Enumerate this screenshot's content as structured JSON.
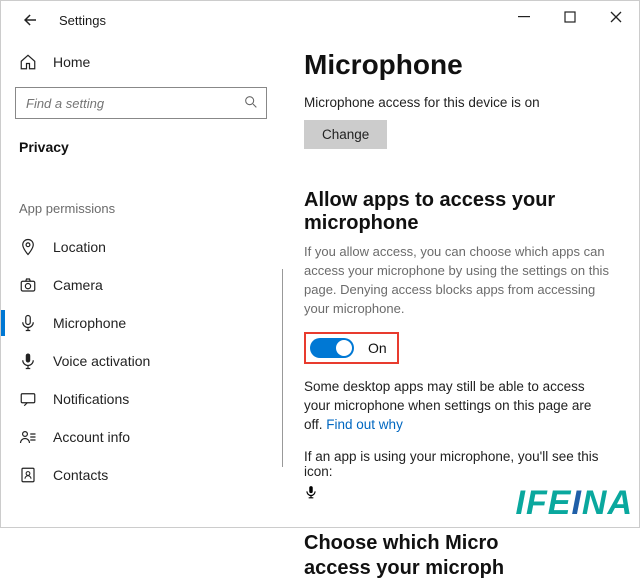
{
  "window": {
    "title": "Settings"
  },
  "sidebar": {
    "home": "Home",
    "search_placeholder": "Find a setting",
    "category": "Privacy",
    "group_label": "App permissions",
    "items": [
      {
        "label": "Location"
      },
      {
        "label": "Camera"
      },
      {
        "label": "Microphone",
        "selected": true
      },
      {
        "label": "Voice activation"
      },
      {
        "label": "Notifications"
      },
      {
        "label": "Account info"
      },
      {
        "label": "Contacts"
      }
    ]
  },
  "content": {
    "title": "Microphone",
    "access_status": "Microphone access for this device is on",
    "change": "Change",
    "allow_heading": "Allow apps to access your microphone",
    "allow_desc": "If you allow access, you can choose which apps can access your microphone by using the settings on this page. Denying access blocks apps from accessing your microphone.",
    "toggle_state": "On",
    "desktop_note": "Some desktop apps may still be able to access your microphone when settings on this page are off. ",
    "find_out_why": "Find out why",
    "usage_note": "If an app is using your microphone, you'll see this icon:",
    "choose_heading_line1": "Choose which Micro",
    "choose_heading_line2": "access your microph"
  },
  "watermark": "IFEINA"
}
